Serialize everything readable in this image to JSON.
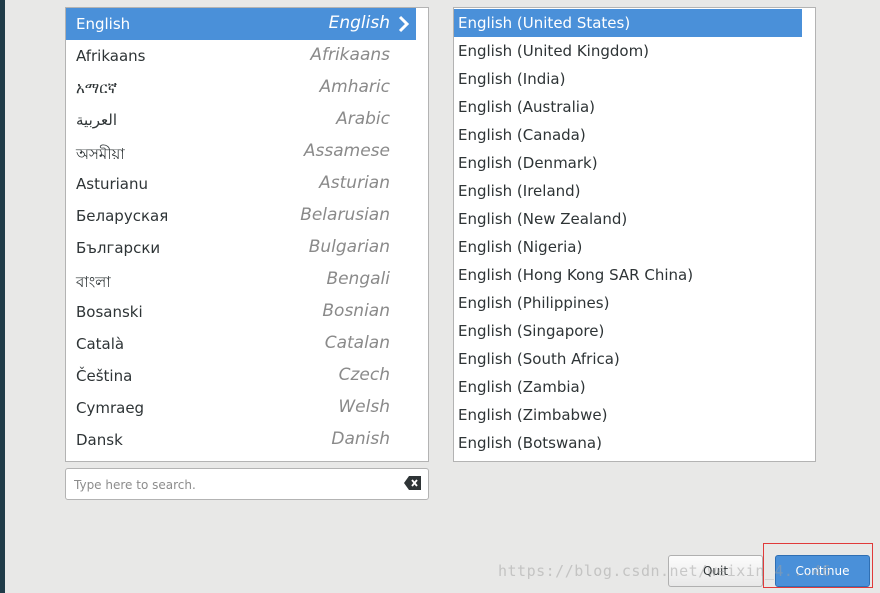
{
  "languages": [
    {
      "native": "English",
      "english": "English"
    },
    {
      "native": "Afrikaans",
      "english": "Afrikaans"
    },
    {
      "native": "አማርኛ",
      "english": "Amharic"
    },
    {
      "native": "العربية",
      "english": "Arabic"
    },
    {
      "native": "অসমীয়া",
      "english": "Assamese"
    },
    {
      "native": "Asturianu",
      "english": "Asturian"
    },
    {
      "native": "Беларуская",
      "english": "Belarusian"
    },
    {
      "native": "Български",
      "english": "Bulgarian"
    },
    {
      "native": "বাংলা",
      "english": "Bengali"
    },
    {
      "native": "Bosanski",
      "english": "Bosnian"
    },
    {
      "native": "Català",
      "english": "Catalan"
    },
    {
      "native": "Čeština",
      "english": "Czech"
    },
    {
      "native": "Cymraeg",
      "english": "Welsh"
    },
    {
      "native": "Dansk",
      "english": "Danish"
    }
  ],
  "selected_language": "English",
  "locales": [
    "English (United States)",
    "English (United Kingdom)",
    "English (India)",
    "English (Australia)",
    "English (Canada)",
    "English (Denmark)",
    "English (Ireland)",
    "English (New Zealand)",
    "English (Nigeria)",
    "English (Hong Kong SAR China)",
    "English (Philippines)",
    "English (Singapore)",
    "English (South Africa)",
    "English (Zambia)",
    "English (Zimbabwe)",
    "English (Botswana)"
  ],
  "selected_locale": "English (United States)",
  "search": {
    "placeholder": "Type here to search.",
    "value": ""
  },
  "buttons": {
    "quit": "Quit",
    "continue": "Continue"
  },
  "watermark": "https://blog.csdn.net/weixin_4...46",
  "icons": {
    "selected_arrow": "chevron-right-icon",
    "clear": "backspace-clear-icon"
  },
  "colors": {
    "selection": "#4a90d9",
    "background": "#e8e8e7",
    "highlight_box": "#e03a3a"
  }
}
